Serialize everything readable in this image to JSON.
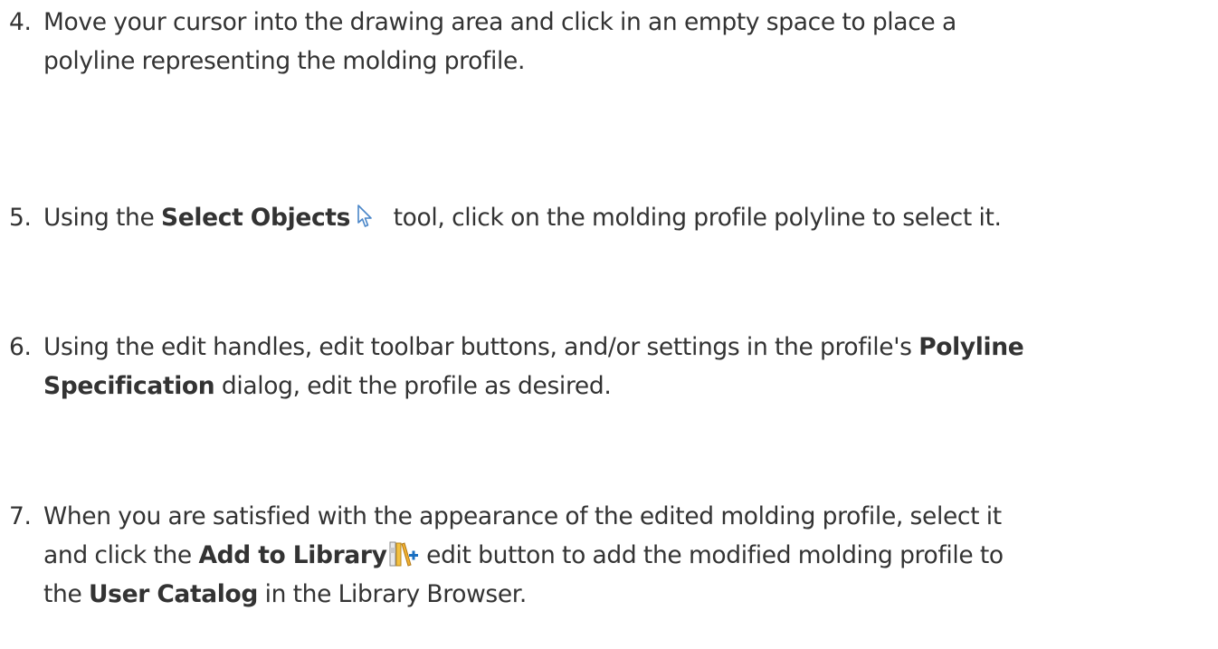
{
  "steps": [
    {
      "num": "4.",
      "line1": "Move your cursor into the drawing area and click in an empty space to place a",
      "line2": "polyline representing the molding profile."
    },
    {
      "num": "5.",
      "pre": "Using the ",
      "bold1": "Select Objects",
      "icon": "select-objects-arrow-icon",
      "post": " tool, click on the molding profile polyline to select it."
    },
    {
      "num": "6.",
      "pre": "Using the edit handles, edit toolbar buttons, and/or settings in the profile's ",
      "bold1": "Polyline",
      "bold2": "Specification",
      "post": " dialog, edit the profile as desired."
    },
    {
      "num": "7.",
      "line1": "When you are satisfied with the appearance of the edited molding profile, select it",
      "pre": "and click the ",
      "bold1": "Add to Library",
      "icon": "add-to-library-icon",
      "mid": " edit button to add the modified molding profile to",
      "pre3": "the ",
      "bold2": "User Catalog",
      "post": " in the Library Browser."
    }
  ],
  "colors": {
    "text": "#333333",
    "cursor_blue": "#4a86c8",
    "library_orange": "#e8a020",
    "plus_blue": "#1a6fc2"
  }
}
